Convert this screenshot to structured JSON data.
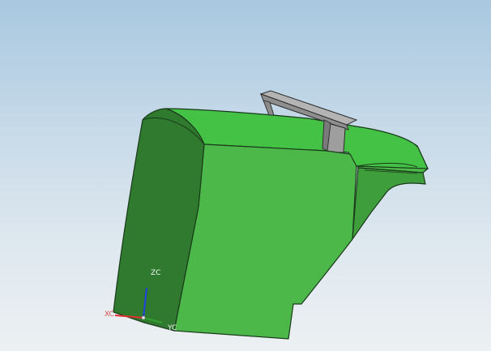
{
  "viewport": {
    "background_top": "#a9c8e0",
    "background_bottom": "#ecf0f3"
  },
  "model": {
    "body_color": "#4cb84a",
    "top_surface_color": "#44c044",
    "side_color": "#2d7a2e",
    "bracket_color": "#9a9a9a",
    "edge_color": "#1a3a1a"
  },
  "triad": {
    "x_label": "XC",
    "y_label": "YC",
    "z_label": "ZC",
    "x_color": "#e03030",
    "y_color": "#30a030",
    "z_color": "#2040e0",
    "x_label_color": "#e05050",
    "label_color": "#f4f4f4"
  }
}
